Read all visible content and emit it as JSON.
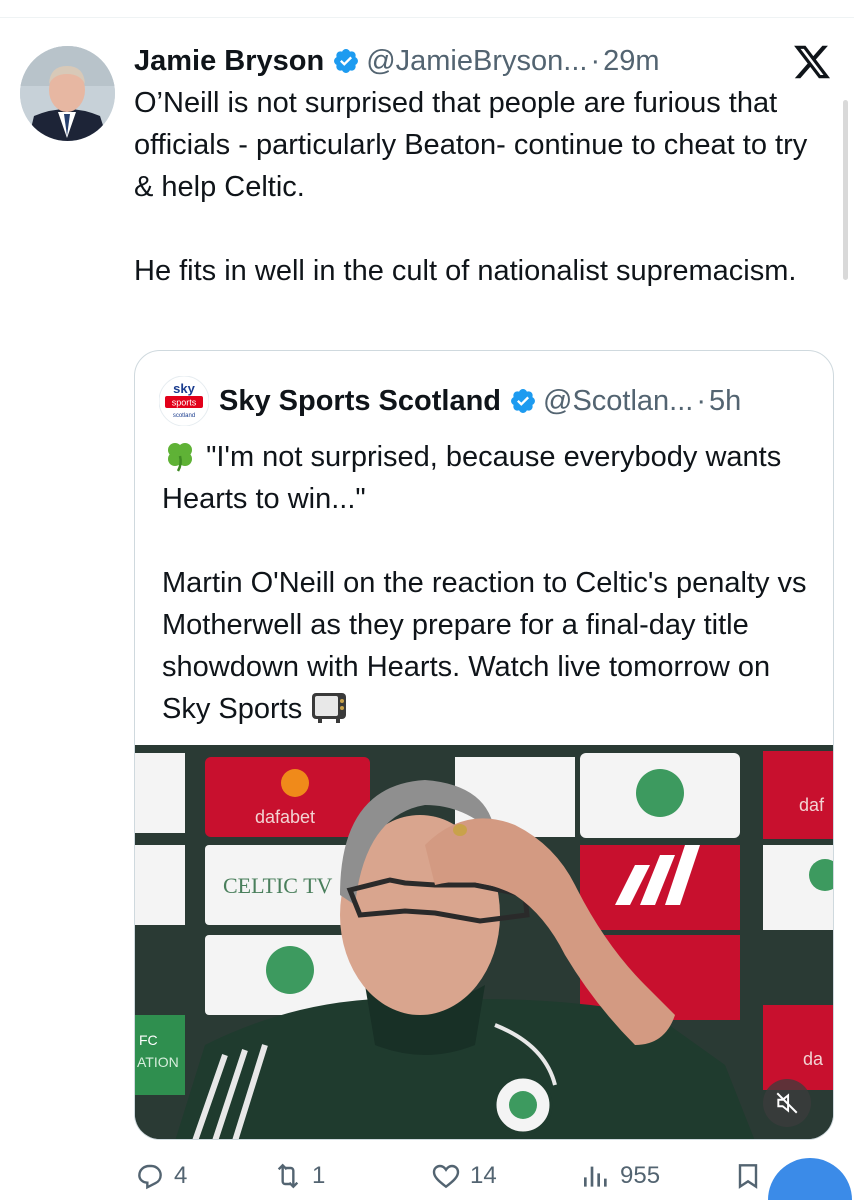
{
  "tweet": {
    "author_name": "Jamie Bryson",
    "handle": "@JamieBryson...",
    "separator": "·",
    "time": "29m",
    "paragraphs": [
      "O’Neill is not surprised that people are furious that officials - particularly Beaton- continue to cheat to try & help Celtic.",
      "He fits in well in the cult of nationalist supremacism."
    ]
  },
  "quote": {
    "author_name": "Sky Sports Scotland",
    "handle": "@Scotlan...",
    "separator": "·",
    "time": "5h",
    "avatar_text": [
      "sky",
      "sports",
      "scotland"
    ],
    "paragraphs": [
      "\"I'm not surprised, because everybody wants Hearts to win...\"",
      "Martin O'Neill on the reaction to Celtic's penalty vs Motherwell as they prepare for a final-day title showdown with Hearts. Watch live tomorrow on Sky Sports"
    ],
    "leading_emoji": "shamrock-icon",
    "trailing_emoji": "tv-icon",
    "media": {
      "sponsor_labels": [
        "dafabet",
        "CELTIC TV",
        "FC",
        "ATION",
        "daf",
        "da"
      ],
      "mute_icon": "mute-icon"
    }
  },
  "actions": {
    "reply_count": "4",
    "retweet_count": "1",
    "like_count": "14",
    "views_count": "955"
  },
  "colors": {
    "text": "#0f1419",
    "secondary": "#536471",
    "verified": "#1d9bf0",
    "border": "#cfd9de",
    "sky_red": "#e2001a",
    "sky_blue": "#1a3c8e",
    "celtic_green": "#1f3b2e"
  }
}
